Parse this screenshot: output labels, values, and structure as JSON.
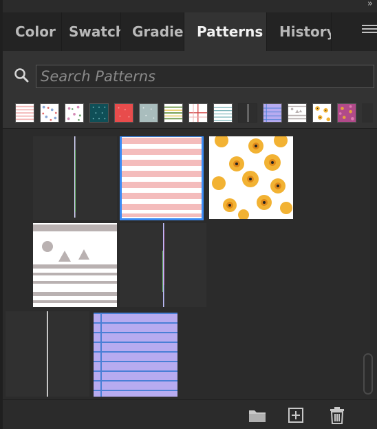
{
  "panel": {
    "collapse_glyph": "»",
    "tabs": [
      {
        "label": "Color",
        "active": false
      },
      {
        "label": "Swatches",
        "active": false
      },
      {
        "label": "Gradient",
        "active": false
      },
      {
        "label": "Patterns",
        "active": true
      },
      {
        "label": "History",
        "active": false
      }
    ],
    "menu_icon": "hamburger-menu-icon"
  },
  "search": {
    "placeholder": "Search Patterns",
    "value": "",
    "icon": "search-icon"
  },
  "recent_patterns": [
    {
      "name": "pink-stripes",
      "colors": [
        "#ffffff",
        "#f4b8b8"
      ]
    },
    {
      "name": "floral-small-1",
      "colors": [
        "#ffffff",
        "#8aa6d6",
        "#e26a6a"
      ]
    },
    {
      "name": "floral-small-2",
      "colors": [
        "#ffffff",
        "#d48ab5",
        "#6aa06a"
      ]
    },
    {
      "name": "teal-dots",
      "colors": [
        "#0f4f57",
        "#7fc2c7"
      ]
    },
    {
      "name": "red-dots",
      "colors": [
        "#e84c4c",
        "#f7a0a0"
      ]
    },
    {
      "name": "grey-dots",
      "colors": [
        "#a9bdbd",
        "#e6eeee"
      ]
    },
    {
      "name": "green-stripes",
      "colors": [
        "#ffffff",
        "#6f9a4a",
        "#e8c24a"
      ]
    },
    {
      "name": "red-plaid",
      "colors": [
        "#ffffff",
        "#d44c4c"
      ]
    },
    {
      "name": "teal-lines",
      "colors": [
        "#ffffff",
        "#4a9aa0"
      ]
    },
    {
      "name": "single-line",
      "colors": [
        "#2e2e2e",
        "#ffffff"
      ]
    },
    {
      "name": "notebook-lavender",
      "colors": [
        "#b7abf0",
        "#4a7fd6"
      ]
    },
    {
      "name": "grey-scene",
      "colors": [
        "#ffffff",
        "#b9b1b1"
      ]
    },
    {
      "name": "yellow-flowers",
      "colors": [
        "#ffffff",
        "#f2b233"
      ]
    },
    {
      "name": "pink-floral",
      "colors": [
        "#b14a8a",
        "#e6a23c"
      ]
    }
  ],
  "grid_patterns": [
    {
      "name": "thin-line-dark",
      "selected": false
    },
    {
      "name": "pink-stripes",
      "selected": true
    },
    {
      "name": "yellow-flowers",
      "selected": false
    },
    {
      "name": "grey-scene",
      "selected": false
    },
    {
      "name": "thin-line-dark-2",
      "selected": false
    },
    {
      "name": "thin-white-line",
      "selected": false
    },
    {
      "name": "notebook-lavender",
      "selected": false
    }
  ],
  "footer": {
    "buttons": [
      {
        "name": "new-folder-icon"
      },
      {
        "name": "add-pattern-icon"
      },
      {
        "name": "delete-icon"
      }
    ]
  },
  "colors": {
    "panel_bg": "#2b2b2b",
    "selection": "#3b8bf5"
  }
}
